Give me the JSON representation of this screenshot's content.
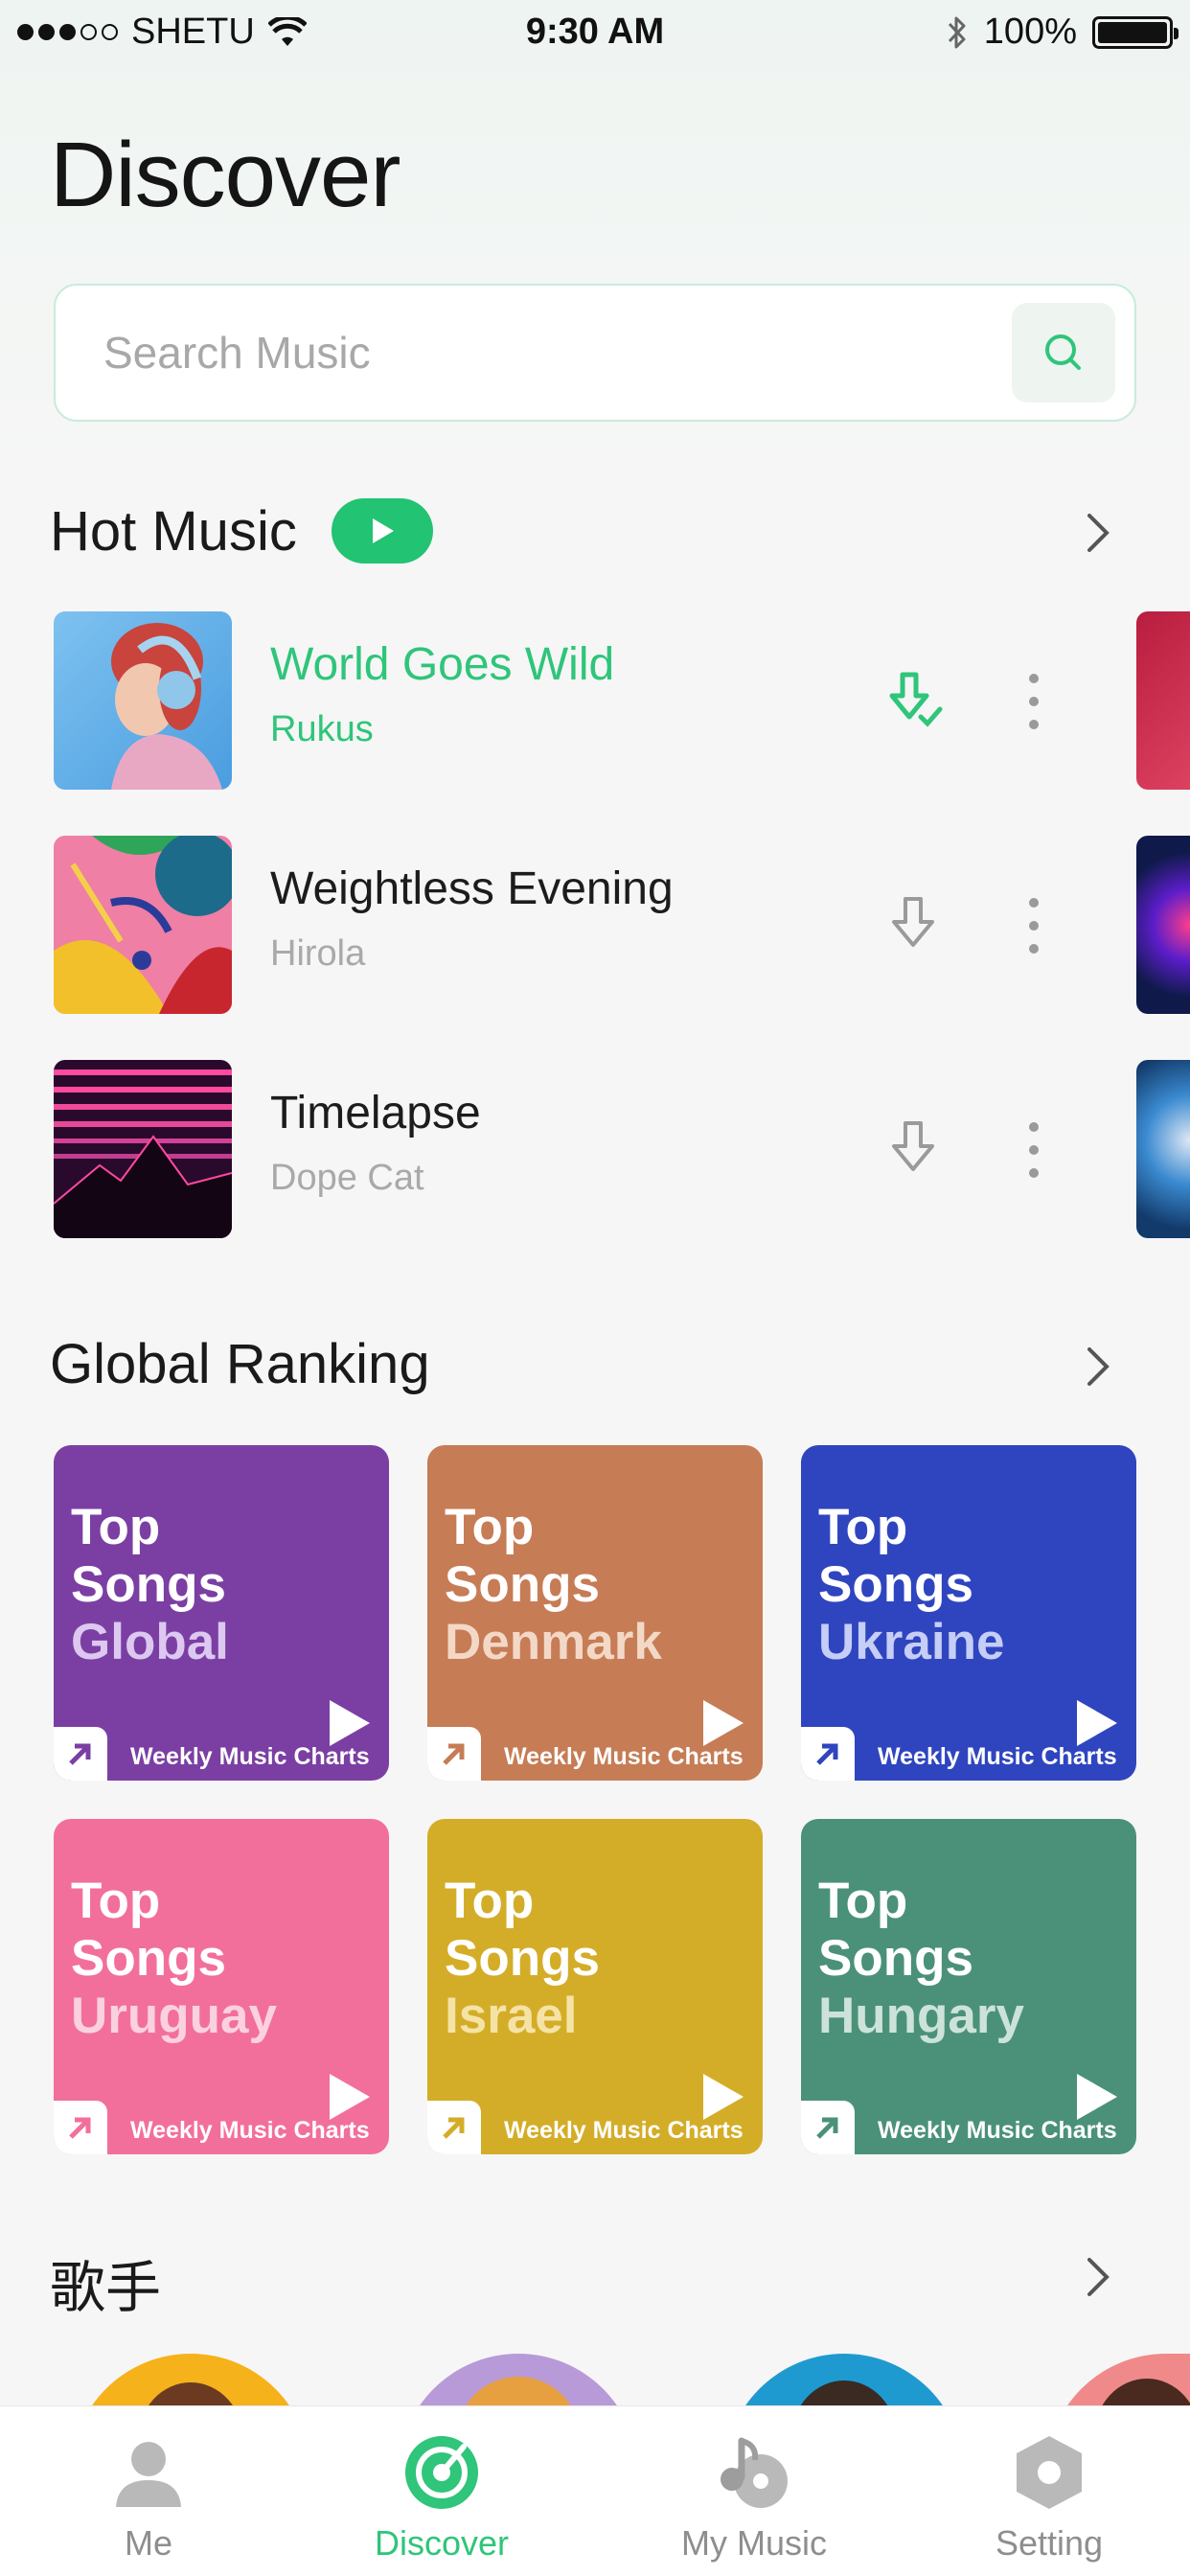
{
  "status_bar": {
    "carrier": "SHETU",
    "time": "9:30 AM",
    "battery": "100%"
  },
  "title": "Discover",
  "search": {
    "placeholder": "Search Music"
  },
  "hot_music": {
    "title": "Hot Music",
    "songs": [
      {
        "title": "World Goes Wild",
        "artist": "Rukus"
      },
      {
        "title": "Weightless Evening",
        "artist": "Hirola"
      },
      {
        "title": "Timelapse",
        "artist": "Dope Cat"
      }
    ]
  },
  "global_ranking": {
    "title": "Global Ranking",
    "cards": [
      {
        "line1": "Top",
        "line2": "Songs",
        "country": "Global",
        "subtitle": "Weekly Music Charts",
        "color": "#7b3fa3",
        "country_color": "#dcc8f0",
        "arrow_color": "#7b3fa3"
      },
      {
        "line1": "Top",
        "line2": "Songs",
        "country": "Denmark",
        "subtitle": "Weekly Music Charts",
        "color": "#c67c55",
        "country_color": "#f3d8c7",
        "arrow_color": "#c67c55"
      },
      {
        "line1": "Top",
        "line2": "Songs",
        "country": "Ukraine",
        "subtitle": "Weekly Music Charts",
        "color": "#2f45bf",
        "country_color": "#c6cdf6",
        "arrow_color": "#2f45bf"
      },
      {
        "line1": "Top",
        "line2": "Songs",
        "country": "Uruguay",
        "subtitle": "Weekly Music Charts",
        "color": "#f26f9c",
        "country_color": "#fbd1e0",
        "arrow_color": "#f26f9c"
      },
      {
        "line1": "Top",
        "line2": "Songs",
        "country": "Israel",
        "subtitle": "Weekly Music Charts",
        "color": "#d4ad28",
        "country_color": "#f5e3a6",
        "arrow_color": "#d4ad28"
      },
      {
        "line1": "Top",
        "line2": "Songs",
        "country": "Hungary",
        "subtitle": "Weekly Music Charts",
        "color": "#4b917a",
        "country_color": "#cde3da",
        "arrow_color": "#4b917a"
      }
    ]
  },
  "singers": {
    "title": "歌手"
  },
  "tabbar": {
    "tabs": [
      {
        "label": "Me"
      },
      {
        "label": "Discover"
      },
      {
        "label": "My Music"
      },
      {
        "label": "Setting"
      }
    ]
  },
  "colors": {
    "accent": "#22c372",
    "accent_text": "#2fc57a",
    "icon_grey": "#9a9a9a"
  }
}
